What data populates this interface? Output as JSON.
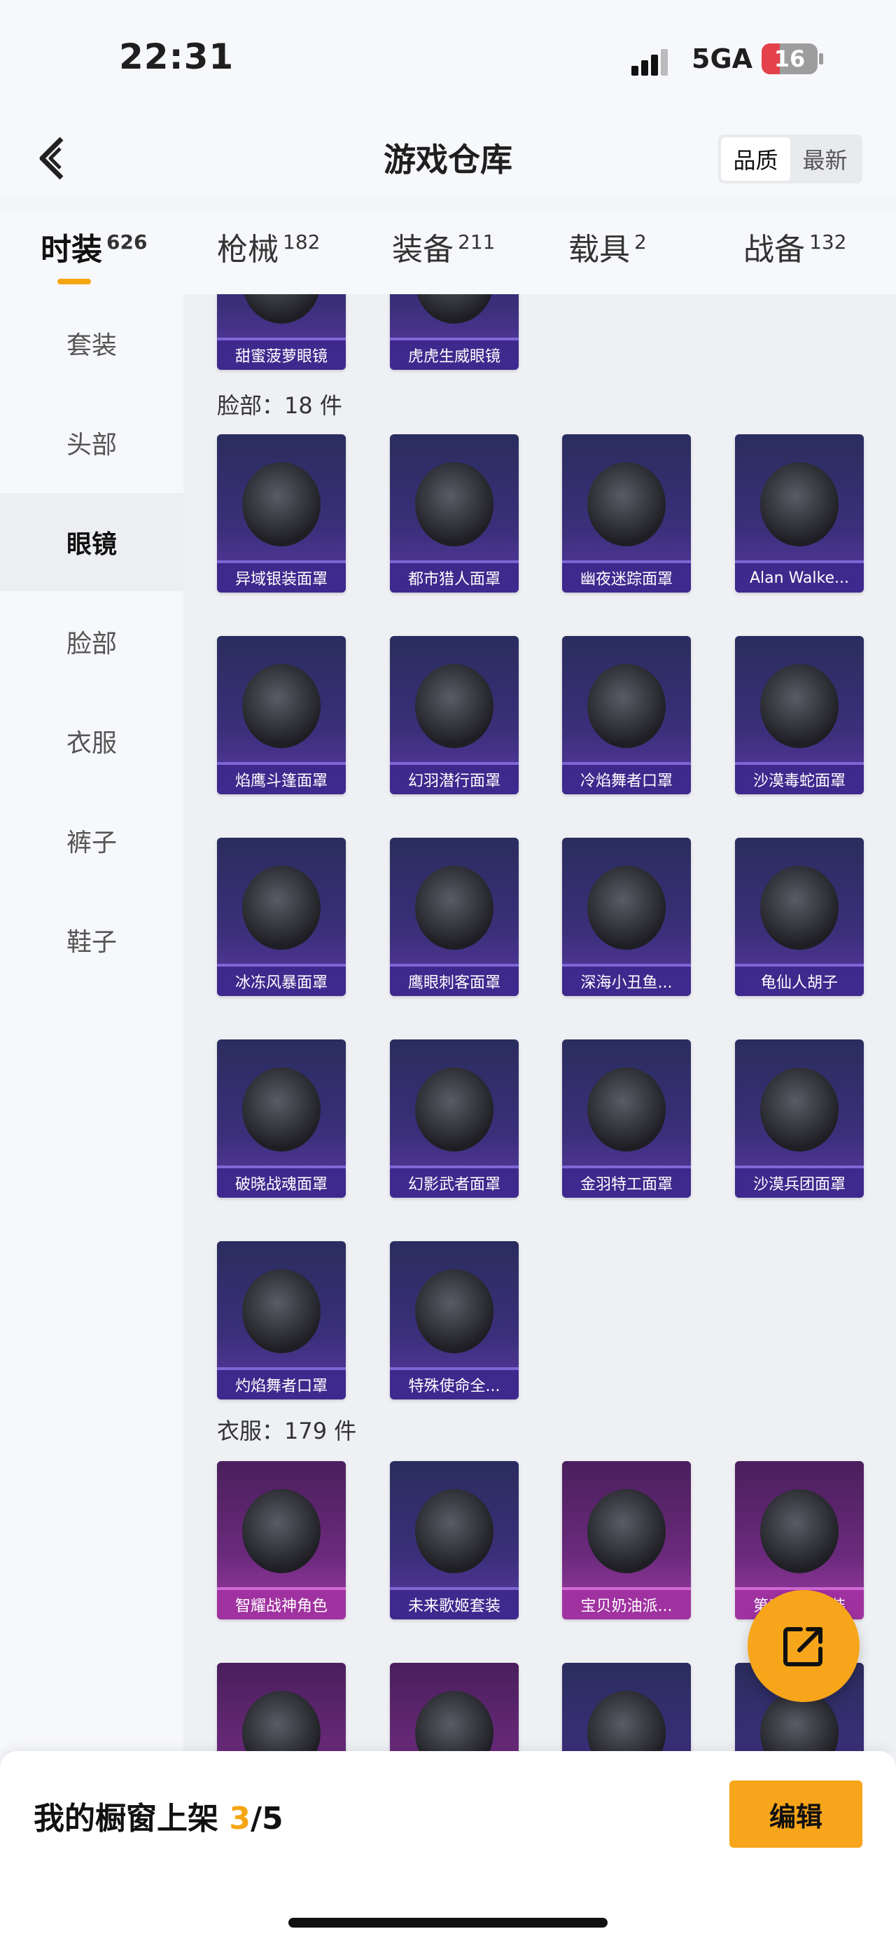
{
  "status": {
    "time": "22:31",
    "network": "5GA",
    "battery": "16",
    "battery_fraction": 0.16
  },
  "nav": {
    "title": "游戏仓库",
    "sort": [
      "品质",
      "最新"
    ],
    "back_icon": "chevron-left-icon"
  },
  "categories": [
    {
      "label": "时装",
      "count": "626"
    },
    {
      "label": "枪械",
      "count": "182"
    },
    {
      "label": "装备",
      "count": "211"
    },
    {
      "label": "载具",
      "count": "2"
    },
    {
      "label": "战备",
      "count": "132"
    }
  ],
  "sidebar": [
    "套装",
    "头部",
    "眼镜",
    "脸部",
    "衣服",
    "裤子",
    "鞋子"
  ],
  "top_partial_cards": [
    "甜蜜菠萝眼镜",
    "虎虎生威眼镜"
  ],
  "face_section": {
    "title": "脸部：18 件",
    "items": [
      "异域银装面罩",
      "都市猎人面罩",
      "幽夜迷踪面罩",
      "Alan Walke...",
      "焰鹰斗篷面罩",
      "幻羽潜行面罩",
      "冷焰舞者口罩",
      "沙漠毒蛇面罩",
      "冰冻风暴面罩",
      "鹰眼刺客面罩",
      "深海小丑鱼...",
      "龟仙人胡子",
      "破晓战魂面罩",
      "幻影武者面罩",
      "金羽特工面罩",
      "沙漠兵团面罩",
      "灼焰舞者口罩",
      "特殊使命全..."
    ]
  },
  "clothes_section": {
    "title": "衣服：179 件",
    "items": [
      "智耀战神角色",
      "未来歌姬套装",
      "宝贝奶油派...",
      "第五人格套装"
    ]
  },
  "share_icon": "share-icon",
  "bottom": {
    "shelf_label": "我的橱窗上架 ",
    "shelf_count": "3",
    "shelf_total": "/5",
    "edit_label": "编辑"
  }
}
